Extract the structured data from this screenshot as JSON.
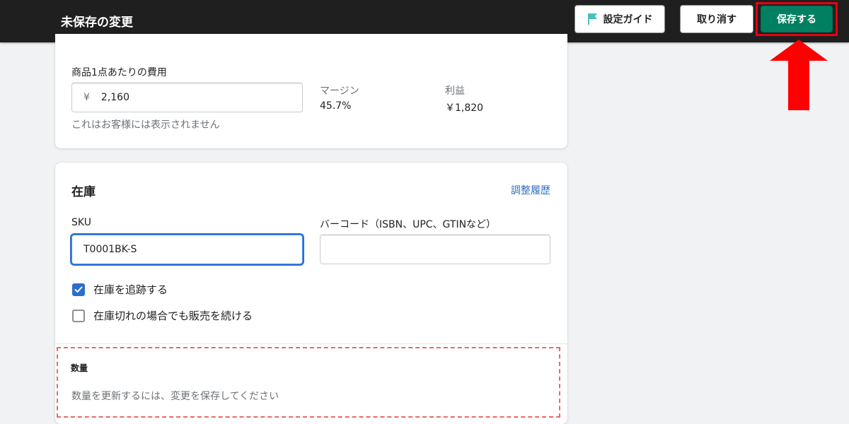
{
  "topbar": {
    "title": "未保存の変更",
    "guide_label": "設定ガイド",
    "cancel_label": "取り消す",
    "save_label": "保存する"
  },
  "pricing": {
    "cost_label": "商品1点あたりの費用",
    "currency_symbol": "¥",
    "cost_value": "2,160",
    "cost_help": "これはお客様には表示されません",
    "margin_label": "マージン",
    "margin_value": "45.7%",
    "profit_label": "利益",
    "profit_value": "￥1,820"
  },
  "inventory": {
    "title": "在庫",
    "history_link": "調整履歴",
    "sku_label": "SKU",
    "sku_value": "T0001BK-S",
    "barcode_label": "バーコード（ISBN、UPC、GTINなど）",
    "barcode_value": "",
    "track_label": "在庫を追跡する",
    "track_checked": true,
    "continue_label": "在庫切れの場合でも販売を続ける",
    "continue_checked": false,
    "quantity_title": "数量",
    "quantity_note": "数量を更新するには、変更を保存してください"
  },
  "colors": {
    "topbar_bg": "#1f1f1f",
    "primary_green": "#008060",
    "link_blue": "#2c6ecb",
    "annotation_red": "#e60012",
    "flag_teal": "#47c1bf"
  },
  "icons": {
    "guide": "flag-icon",
    "checkbox": "checkmark-icon",
    "annotation": "up-arrow-icon"
  }
}
